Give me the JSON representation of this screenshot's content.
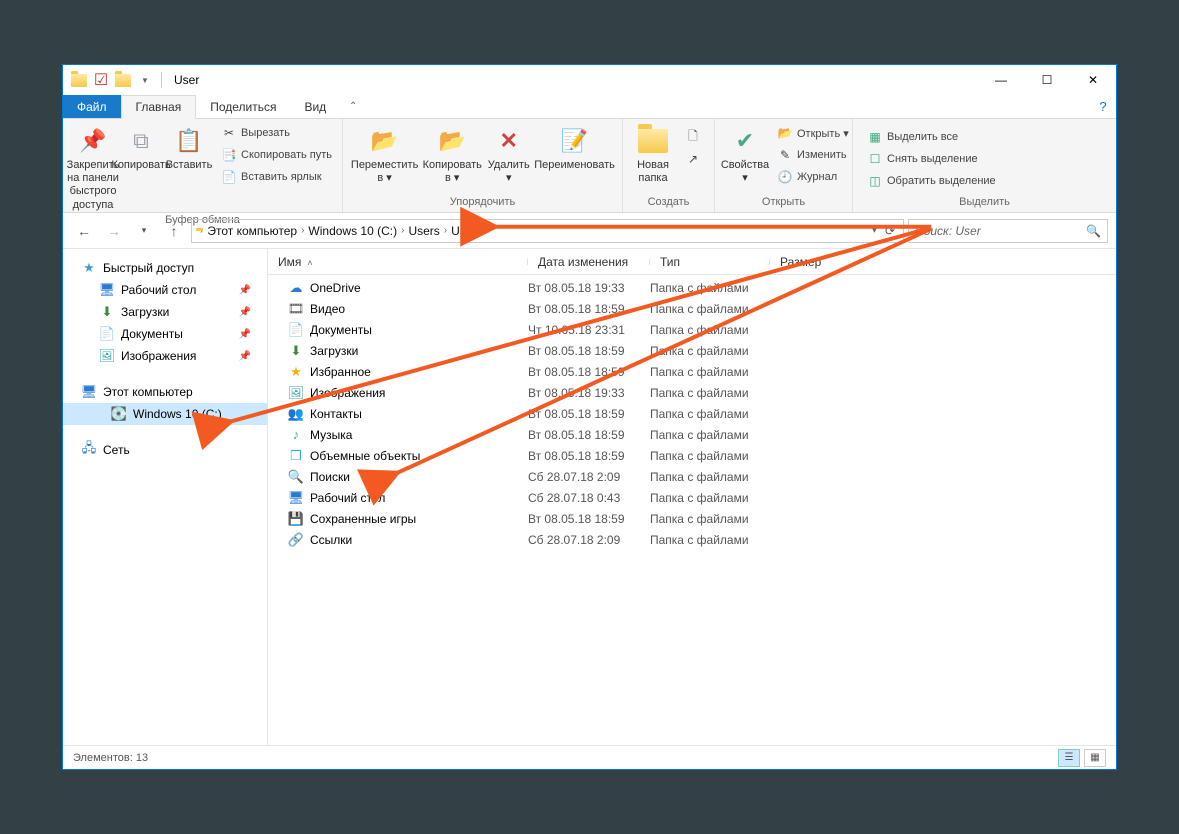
{
  "window": {
    "title": "User"
  },
  "tabs": {
    "file": "Файл",
    "home": "Главная",
    "share": "Поделиться",
    "view": "Вид"
  },
  "ribbon": {
    "clipboard": {
      "pin": "Закрепить на панели\nбыстрого доступа",
      "copy": "Копировать",
      "paste": "Вставить",
      "cut": "Вырезать",
      "copypath": "Скопировать путь",
      "pasteshortcut": "Вставить ярлык",
      "label": "Буфер обмена"
    },
    "organize": {
      "move": "Переместить\nв ▾",
      "copyto": "Копировать\nв ▾",
      "delete": "Удалить\n▾",
      "rename": "Переименовать",
      "label": "Упорядочить"
    },
    "create": {
      "newfolder": "Новая\nпапка",
      "label": "Создать"
    },
    "open": {
      "properties": "Свойства\n▾",
      "open_item": "Открыть ▾",
      "edit": "Изменить",
      "history": "Журнал",
      "label": "Открыть"
    },
    "select": {
      "all": "Выделить все",
      "none": "Снять выделение",
      "invert": "Обратить выделение",
      "label": "Выделить"
    }
  },
  "breadcrumb": [
    "Этот компьютер",
    "Windows 10 (C:)",
    "Users",
    "User"
  ],
  "search": {
    "placeholder": "Поиск: User"
  },
  "sidebar": {
    "quick": {
      "label": "Быстрый доступ",
      "items": [
        "Рабочий стол",
        "Загрузки",
        "Документы",
        "Изображения"
      ]
    },
    "pc": {
      "label": "Этот компьютер",
      "drive": "Windows 10 (C:)"
    },
    "network": "Сеть"
  },
  "columns": {
    "name": "Имя",
    "date": "Дата изменения",
    "type": "Тип",
    "size": "Размер"
  },
  "files": [
    {
      "icon": "☁",
      "name": "OneDrive",
      "date": "Вт 08.05.18 19:33",
      "type": "Папка с файлами",
      "color": "#2a7ad4"
    },
    {
      "icon": "🎞",
      "name": "Видео",
      "date": "Вт 08.05.18 18:59",
      "type": "Папка с файлами",
      "color": "#555"
    },
    {
      "icon": "📄",
      "name": "Документы",
      "date": "Чт 10.05.18 23:31",
      "type": "Папка с файлами",
      "color": "#6aa7de"
    },
    {
      "icon": "⬇",
      "name": "Загрузки",
      "date": "Вт 08.05.18 18:59",
      "type": "Папка с файлами",
      "color": "#3c883c"
    },
    {
      "icon": "★",
      "name": "Избранное",
      "date": "Вт 08.05.18 18:59",
      "type": "Папка с файлами",
      "color": "#f3b300"
    },
    {
      "icon": "🖼",
      "name": "Изображения",
      "date": "Вт 08.05.18 19:33",
      "type": "Папка с файлами",
      "color": "#3fa9b7"
    },
    {
      "icon": "👥",
      "name": "Контакты",
      "date": "Вт 08.05.18 18:59",
      "type": "Папка с файлами",
      "color": "#5a8"
    },
    {
      "icon": "♪",
      "name": "Музыка",
      "date": "Вт 08.05.18 18:59",
      "type": "Папка с файлами",
      "color": "#4aa"
    },
    {
      "icon": "❒",
      "name": "Объемные объекты",
      "date": "Вт 08.05.18 18:59",
      "type": "Папка с файлами",
      "color": "#3aa9c9"
    },
    {
      "icon": "🔍",
      "name": "Поиски",
      "date": "Сб 28.07.18 2:09",
      "type": "Папка с файлами",
      "color": "#4a8fc7"
    },
    {
      "icon": "🖥",
      "name": "Рабочий стол",
      "date": "Сб 28.07.18 0:43",
      "type": "Папка с файлами",
      "color": "#2a7ad4"
    },
    {
      "icon": "💾",
      "name": "Сохраненные игры",
      "date": "Вт 08.05.18 18:59",
      "type": "Папка с файлами",
      "color": "#3c883c"
    },
    {
      "icon": "🔗",
      "name": "Ссылки",
      "date": "Сб 28.07.18 2:09",
      "type": "Папка с файлами",
      "color": "#2a7ad4"
    }
  ],
  "status": {
    "count": "Элементов: 13"
  }
}
